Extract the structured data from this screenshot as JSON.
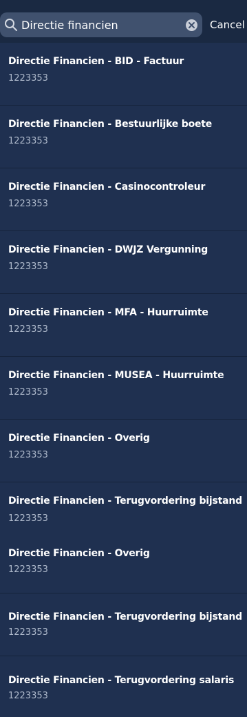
{
  "search": {
    "value": "Directie financien",
    "cancel_label": "Cancel",
    "search_icon": "search-icon",
    "clear_icon": "clear-icon"
  },
  "colors": {
    "background": "#1f3050",
    "search_field": "#40516e",
    "text": "#ffffff",
    "subtext": "#aeb9cb"
  },
  "results": [
    {
      "title": "Directie Financien - BID - Factuur",
      "code": "1223353"
    },
    {
      "title": "Directie Financien - Bestuurlijke boete",
      "code": "1223353"
    },
    {
      "title": "Directie Financien - Casinocontroleur",
      "code": "1223353"
    },
    {
      "title": "Directie Financien - DWJZ Vergunning",
      "code": "1223353"
    },
    {
      "title": "Directie Financien - MFA - Huurruimte",
      "code": "1223353"
    },
    {
      "title": "Directie Financien - MUSEA - Huurruimte",
      "code": "1223353"
    },
    {
      "title": "Directie Financien - Overig",
      "code": "1223353"
    },
    {
      "title": "Directie Financien - Terugvordering bijstand",
      "code": "1223353"
    },
    {
      "title": "Directie Financien - Overig",
      "code": "1223353"
    },
    {
      "title": "Directie Financien - Terugvordering bijstand",
      "code": "1223353"
    },
    {
      "title": "Directie Financien - Terugvordering salaris",
      "code": "1223353"
    }
  ]
}
